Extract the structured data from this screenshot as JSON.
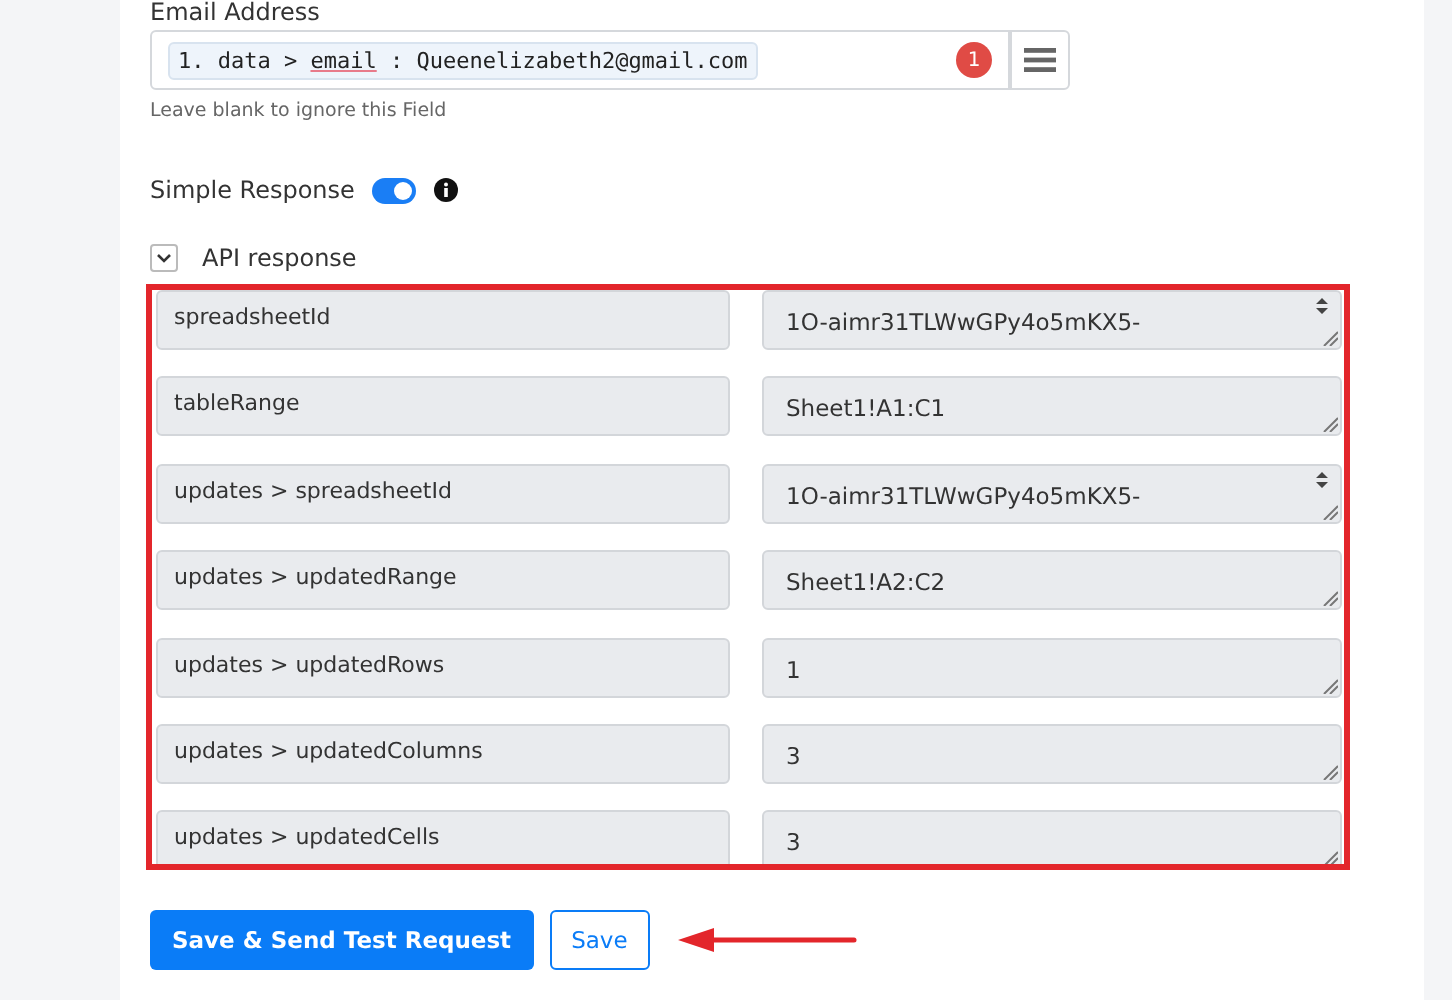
{
  "email_field": {
    "label": "Email Address",
    "token": {
      "prefix": "1. data > ",
      "key": "email",
      "suffix": " : Queenelizabeth2@gmail.com"
    },
    "badge": "1",
    "hint": "Leave blank to ignore this Field"
  },
  "simple_response": {
    "label": "Simple Response",
    "on": true
  },
  "api_response": {
    "label": "API response",
    "expanded": true,
    "rows": [
      {
        "key": "spreadsheetId",
        "value": "1O-aimr31TLWwGPy4o5mKX5-",
        "scrollable": true
      },
      {
        "key": "tableRange",
        "value": "Sheet1!A1:C1",
        "scrollable": false
      },
      {
        "key": "updates > spreadsheetId",
        "value": "1O-aimr31TLWwGPy4o5mKX5-",
        "scrollable": true
      },
      {
        "key": "updates > updatedRange",
        "value": "Sheet1!A2:C2",
        "scrollable": false
      },
      {
        "key": "updates > updatedRows",
        "value": "1",
        "scrollable": false
      },
      {
        "key": "updates > updatedColumns",
        "value": "3",
        "scrollable": false
      },
      {
        "key": "updates > updatedCells",
        "value": "3",
        "scrollable": false
      }
    ]
  },
  "buttons": {
    "primary": "Save & Send Test Request",
    "secondary": "Save"
  }
}
